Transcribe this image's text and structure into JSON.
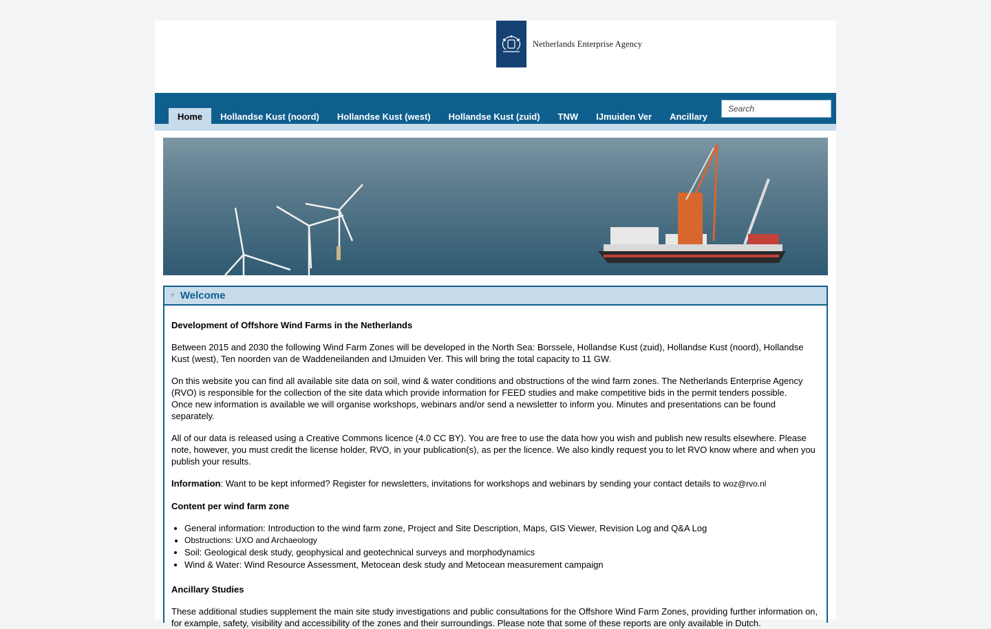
{
  "header": {
    "agency_name": "Netherlands Enterprise Agency"
  },
  "nav": {
    "tabs": [
      "Home",
      "Hollandse Kust (noord)",
      "Hollandse Kust (west)",
      "Hollandse Kust (zuid)",
      "TNW",
      "IJmuiden Ver",
      "Ancillary"
    ],
    "active": "Home",
    "search_placeholder": "Search"
  },
  "colors": {
    "brand": "#0f5f8e",
    "tab_highlight": "#c8dbeb",
    "logo_blue": "#154273"
  },
  "welcome": {
    "title": "Welcome",
    "heading": "Development of Offshore Wind Farms in the Netherlands",
    "p1": "Between 2015 and 2030 the following Wind Farm Zones will be developed in the North Sea: Borssele, Hollandse Kust (zuid), Hollandse Kust (noord), Hollandse Kust (west), Ten noorden van de Waddeneilanden and IJmuiden Ver. This will bring the total capacity to 11 GW.",
    "p2a": "On this website you can find all available site data on soil, wind & water conditions and obstructions of the wind farm zones. The Netherlands Enterprise Agency (RVO) is responsible for the collection of the site data which provide information for FEED studies and make competitive bids in the permit tenders possible.",
    "p2b": "Once new information is available we will organise workshops, webinars and/or send a newsletter to inform you. Minutes and presentations can be found separately.",
    "p3": "All of our data is released using a Creative Commons licence (4.0 CC BY). You are free to use the data how you wish and publish new results elsewhere. Please note, however, you must credit the license holder, RVO, in your publication(s), as per the licence. We also kindly request you to let RVO know where and when you publish your results.",
    "info_label": "Information",
    "info_text": ": Want to be kept informed? Register for newsletters, invitations for workshops and webinars by sending your contact details to ",
    "info_email": "woz@rvo.nl",
    "content_heading": "Content per wind farm zone",
    "content_items": [
      "General information: Introduction to the wind farm zone, Project and Site Description, Maps, GIS Viewer, Revision Log and Q&A Log",
      "Obstructions: UXO and Archaeology",
      "Soil: Geological desk study, geophysical and geotechnical surveys and morphodynamics",
      "Wind & Water: Wind Resource Assessment, Metocean desk study and Metocean measurement campaign"
    ],
    "ancillary_heading": "Ancillary Studies",
    "ancillary_text": "These additional studies supplement the main site study investigations and public consultations for the Offshore Wind Farm Zones, providing further information on, for example, safety, visibility and accessibility of the zones and their surroundings. Please note that some of these reports are only available in Dutch."
  }
}
